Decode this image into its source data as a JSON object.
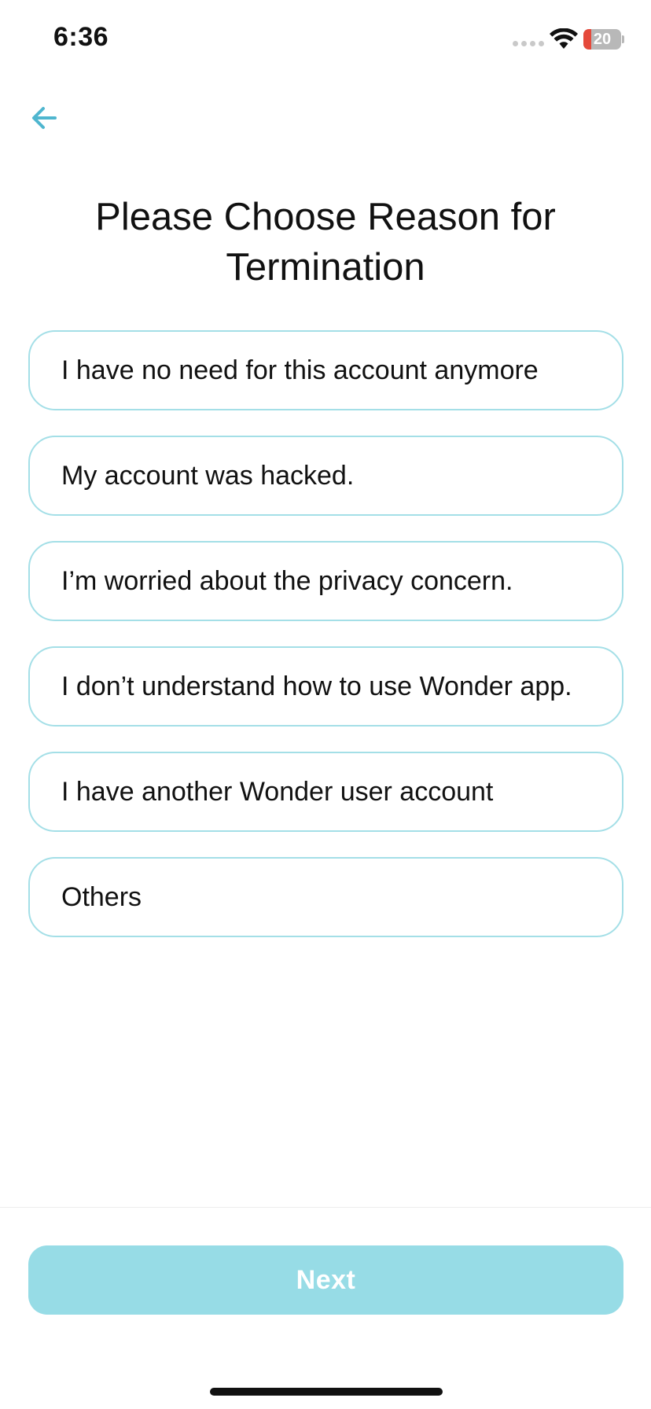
{
  "status_bar": {
    "time": "6:36",
    "battery_percent": "20",
    "battery_level": 0.2,
    "battery_color": "#e5493b",
    "icons": [
      "signal-dots-icon",
      "wifi-icon",
      "battery-icon"
    ]
  },
  "nav": {
    "back_icon": "arrow-left-icon",
    "accent_color": "#4fb6cf"
  },
  "title": "Please Choose Reason for Termination",
  "options": [
    "I have no need for this account anymore",
    "My account was hacked.",
    "I’m worried about the privacy concern.",
    "I don’t understand how to use Wonder app.",
    "I have another Wonder user account",
    "Others"
  ],
  "next_button": {
    "label": "Next",
    "color": "#97dce6"
  },
  "colors": {
    "option_border": "#a4dfe7",
    "text": "#111111"
  }
}
